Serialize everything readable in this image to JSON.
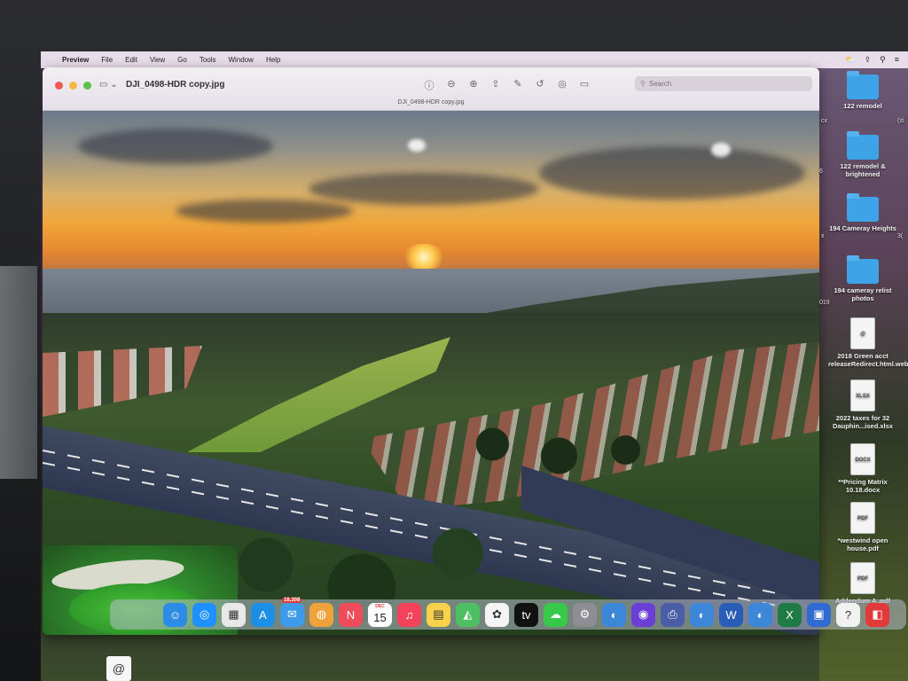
{
  "menubar": {
    "apple": "",
    "app": "Preview",
    "items": [
      "File",
      "Edit",
      "View",
      "Go",
      "Tools",
      "Window",
      "Help"
    ],
    "status_icons": [
      "⛅",
      "⇪",
      "⚲",
      "≡"
    ]
  },
  "window": {
    "title": "DJI_0498-HDR copy.jpg",
    "subtitle": "DJI_0498-HDR copy.jpg",
    "search_placeholder": "Search",
    "toolbar_icons": [
      "info-icon",
      "zoom-out-icon",
      "zoom-in-icon",
      "share-icon",
      "markup-icon",
      "rotate-icon",
      "highlight-icon",
      "annotate-icon"
    ]
  },
  "desktop": {
    "icons": [
      {
        "label": "122 remodel",
        "type": "folder"
      },
      {
        "label": "122 remodel & brightened",
        "type": "folder"
      },
      {
        "label": "194 Cameray Heights",
        "type": "folder"
      },
      {
        "label": "194 cameray relist photos",
        "type": "folder"
      },
      {
        "label": "2018 Green acct releaseRedirect.html.webloc",
        "type": "file",
        "glyph": "@"
      },
      {
        "label": "2022 taxes for 32 Dauphin...ised.xlsx",
        "type": "file",
        "glyph": "XLSX"
      },
      {
        "label": "**Pricing Matrix 10.18.docx",
        "type": "file",
        "glyph": "DOCX"
      },
      {
        "label": "*westwind open house.pdf",
        "type": "file",
        "glyph": "PDF"
      },
      {
        "label": "Addendum A .pdf",
        "type": "file",
        "glyph": "PDF"
      }
    ],
    "edge_labels": [
      "cx",
      "(zi",
      "6",
      "x",
      "3(",
      "019"
    ]
  },
  "dock": {
    "mail_badge": "18,308",
    "calendar_month": "DEC",
    "calendar_day": "15",
    "apps": [
      {
        "name": "finder",
        "glyph": "☺",
        "color": "#2d8ce6"
      },
      {
        "name": "safari",
        "glyph": "◎",
        "color": "#1e90ff"
      },
      {
        "name": "launchpad",
        "glyph": "▦",
        "color": "#e8e8e8"
      },
      {
        "name": "app-store",
        "glyph": "A",
        "color": "#1b8fe6"
      },
      {
        "name": "mail",
        "glyph": "✉",
        "color": "#3d9bea"
      },
      {
        "name": "contacts",
        "glyph": "◍",
        "color": "#f0a23a"
      },
      {
        "name": "news",
        "glyph": "N",
        "color": "#f04b5a"
      },
      {
        "name": "calendar",
        "glyph": "",
        "color": "#ffffff"
      },
      {
        "name": "music",
        "glyph": "♫",
        "color": "#f3435a"
      },
      {
        "name": "notes",
        "glyph": "▤",
        "color": "#f7d24a"
      },
      {
        "name": "maps",
        "glyph": "◭",
        "color": "#4fbf63"
      },
      {
        "name": "photos",
        "glyph": "✿",
        "color": "#f5f5f5"
      },
      {
        "name": "apple-tv",
        "glyph": "tv",
        "color": "#111111"
      },
      {
        "name": "messages",
        "glyph": "☁",
        "color": "#37c94a"
      },
      {
        "name": "system-settings",
        "glyph": "⚙",
        "color": "#8d8d93"
      },
      {
        "name": "globe-app-1",
        "glyph": "◐",
        "color": "#3c87d8"
      },
      {
        "name": "siri",
        "glyph": "◉",
        "color": "#6b3fd6"
      },
      {
        "name": "printer",
        "glyph": "⎙",
        "color": "#4a5ea8"
      },
      {
        "name": "globe-app-2",
        "glyph": "◐",
        "color": "#3c87d8"
      },
      {
        "name": "word",
        "glyph": "W",
        "color": "#2a5db8"
      },
      {
        "name": "globe-app-3",
        "glyph": "◐",
        "color": "#3c87d8"
      },
      {
        "name": "excel",
        "glyph": "X",
        "color": "#1f7a43"
      },
      {
        "name": "screen-sharing",
        "glyph": "▣",
        "color": "#2f6bd1"
      },
      {
        "name": "help",
        "glyph": "?",
        "color": "#f2f2f2"
      },
      {
        "name": "remote-app",
        "glyph": "◧",
        "color": "#e23a3a"
      }
    ]
  }
}
